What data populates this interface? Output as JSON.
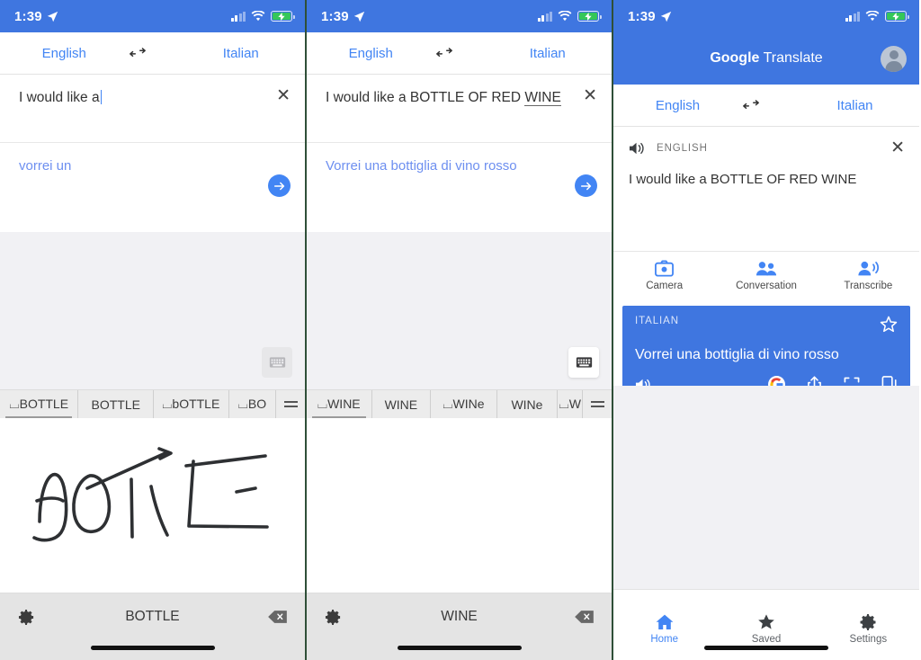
{
  "status": {
    "time": "1:39",
    "location_icon": "location-arrow-icon",
    "signal_icon": "cellular-signal-icon",
    "wifi_icon": "wifi-icon",
    "battery_icon": "battery-charging-icon"
  },
  "colors": {
    "brand_blue": "#3f76e0",
    "link_blue": "#4285f4",
    "translation_blue": "#6d8ff0",
    "gray_body": "#f1f1f4",
    "candidate_bar": "#ececec",
    "hw_bar": "#e4e4e4"
  },
  "panel1": {
    "languages": {
      "source": "English",
      "swap_icon": "swap-languages-icon",
      "target": "Italian"
    },
    "input": {
      "text": "I would like a",
      "clear_icon": "clear-x-icon",
      "has_caret": true
    },
    "translation": {
      "text": "vorrei un",
      "go_icon": "arrow-right-circle-icon"
    },
    "keyboard_toggle_icon": "keyboard-icon",
    "candidates": [
      {
        "label": "⌴BOTTLE",
        "selected": true
      },
      {
        "label": "BOTTLE",
        "selected": false
      },
      {
        "label": "⌴bOTTLE",
        "selected": false
      },
      {
        "label": "⌴BO",
        "selected": false
      }
    ],
    "candidates_more_icon": "hamburger-more-icon",
    "handwriting": {
      "ink_word": "BOTTLE",
      "has_ink": true
    },
    "hwbar": {
      "settings_icon": "gear-icon",
      "word": "BOTTLE",
      "backspace_icon": "backspace-icon"
    }
  },
  "panel2": {
    "languages": {
      "source": "English",
      "swap_icon": "swap-languages-icon",
      "target": "Italian"
    },
    "input": {
      "text_plain": "I would like a BOTTLE OF RED ",
      "text_composing": "WINE",
      "clear_icon": "clear-x-icon"
    },
    "translation": {
      "text": "Vorrei una bottiglia di vino rosso",
      "go_icon": "arrow-right-circle-icon"
    },
    "keyboard_toggle_icon": "keyboard-icon",
    "candidates": [
      {
        "label": "⌴WINE",
        "selected": true
      },
      {
        "label": "WINE",
        "selected": false
      },
      {
        "label": "⌴WINe",
        "selected": false
      },
      {
        "label": "WINe",
        "selected": false
      },
      {
        "label": "⌴W",
        "selected": false
      }
    ],
    "candidates_more_icon": "hamburger-more-icon",
    "handwriting": {
      "ink_word": "",
      "has_ink": false
    },
    "hwbar": {
      "settings_icon": "gear-icon",
      "word": "WINE",
      "backspace_icon": "backspace-icon"
    }
  },
  "panel3": {
    "header": {
      "title_bold": "Google",
      "title_light": " Translate",
      "avatar_icon": "account-avatar-icon"
    },
    "languages": {
      "source": "English",
      "swap_icon": "swap-languages-icon",
      "target": "Italian"
    },
    "source_card": {
      "speaker_icon": "volume-speaker-icon",
      "lang_label": "ENGLISH",
      "close_icon": "close-x-icon",
      "text": "I would like a BOTTLE OF RED WINE"
    },
    "actions": [
      {
        "icon": "camera-icon",
        "label": "Camera"
      },
      {
        "icon": "conversation-people-icon",
        "label": "Conversation"
      },
      {
        "icon": "transcribe-mic-icon",
        "label": "Transcribe"
      }
    ],
    "result_card": {
      "lang_label": "ITALIAN",
      "star_icon": "star-outline-icon",
      "text": "Vorrei una bottiglia di vino rosso",
      "speaker_icon": "volume-speaker-icon",
      "google_icon": "google-g-icon",
      "share_icon": "share-icon",
      "fullscreen_icon": "fullscreen-icon",
      "copy_icon": "copy-icon"
    },
    "navbar": [
      {
        "icon": "home-icon",
        "label": "Home",
        "active": true
      },
      {
        "icon": "star-icon",
        "label": "Saved",
        "active": false
      },
      {
        "icon": "gear-icon",
        "label": "Settings",
        "active": false
      }
    ]
  }
}
